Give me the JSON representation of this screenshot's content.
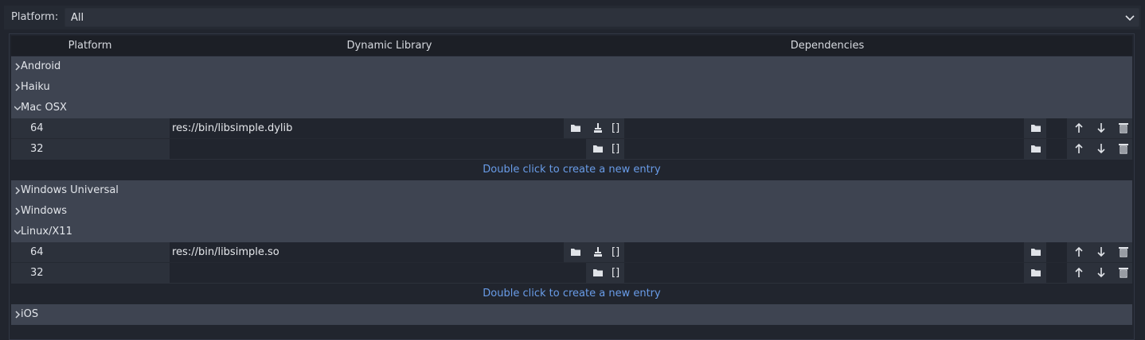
{
  "platform_filter": {
    "label": "Platform:",
    "value": "All"
  },
  "columns": {
    "platform": "Platform",
    "library": "Dynamic Library",
    "deps": "Dependencies"
  },
  "groups": {
    "android": "Android",
    "haiku": "Haiku",
    "macosx": "Mac OSX",
    "winuni": "Windows Universal",
    "windows": "Windows",
    "linux": "Linux/X11",
    "ios": "iOS"
  },
  "mac_rows": [
    {
      "arch": "64",
      "library": "res://bin/libsimple.dylib",
      "deps": "[]"
    },
    {
      "arch": "32",
      "library": "",
      "deps": "[]"
    }
  ],
  "linux_rows": [
    {
      "arch": "64",
      "library": "res://bin/libsimple.so",
      "deps": "[]"
    },
    {
      "arch": "32",
      "library": "",
      "deps": "[]"
    }
  ],
  "new_entry_hint": "Double click to create a new entry",
  "icons": {
    "folder": "folder-icon",
    "clear": "clear-icon",
    "up": "move-up-icon",
    "down": "move-down-icon",
    "remove": "remove-icon"
  }
}
